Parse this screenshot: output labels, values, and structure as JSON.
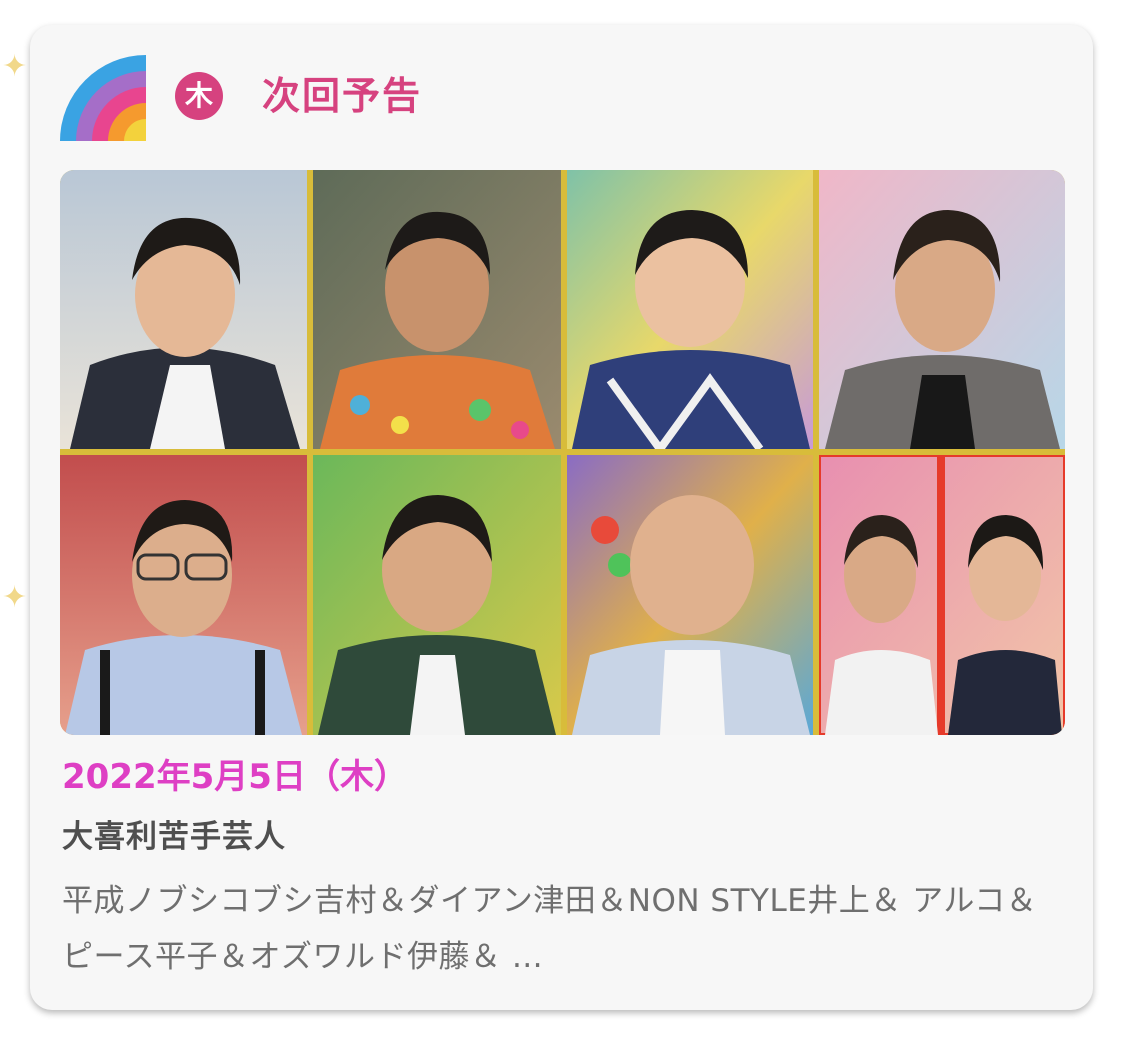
{
  "header": {
    "day_badge": "木",
    "title": "次回予告",
    "logo_icon": "rainbow-logo-icon"
  },
  "colors": {
    "accent_pink": "#d6427f",
    "date_magenta": "#de3fc4",
    "card_bg": "#f7f7f7",
    "title_gray": "#4f4f4f",
    "desc_gray": "#6f6f6f"
  },
  "episode": {
    "date": "2022年5月5日（木）",
    "title": "大喜利苦手芸人",
    "description": "平成ノブシコブシ吉村＆ダイアン津田＆NON STYLE井上＆ アルコ＆ピース平子＆オズワルド伊藤＆ …"
  },
  "photos": {
    "count_label": "8"
  }
}
